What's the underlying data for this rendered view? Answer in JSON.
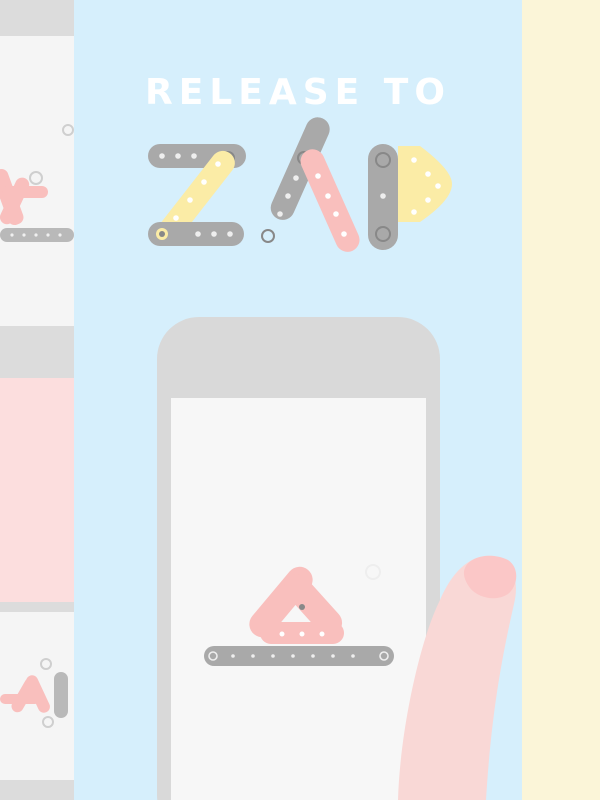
{
  "screen": {
    "headline": "RELEASE TO",
    "logo_word": "ZAP"
  },
  "colors": {
    "main_panel_bg": "#d6effc",
    "right_panel_bg": "#fbf5d8",
    "left_strip_bg": "#f5f5f5",
    "left_strip_bar": "#dcdcdc",
    "left_strip_pink": "#fcdede",
    "phone_body": "#d9d9d9",
    "phone_screen": "#f7f7f7",
    "strut_gray": "#a9a9a9",
    "strut_yellow": "#fbeca6",
    "strut_pink": "#f9bfbd",
    "hand_skin": "#f9d8d6",
    "thumbnail_pink": "#fbc7c7"
  },
  "icons": {
    "logo": "zap-logo-built-from-meccano-struts",
    "screw": "screw-x-icon",
    "hand": "thumb-hand"
  }
}
